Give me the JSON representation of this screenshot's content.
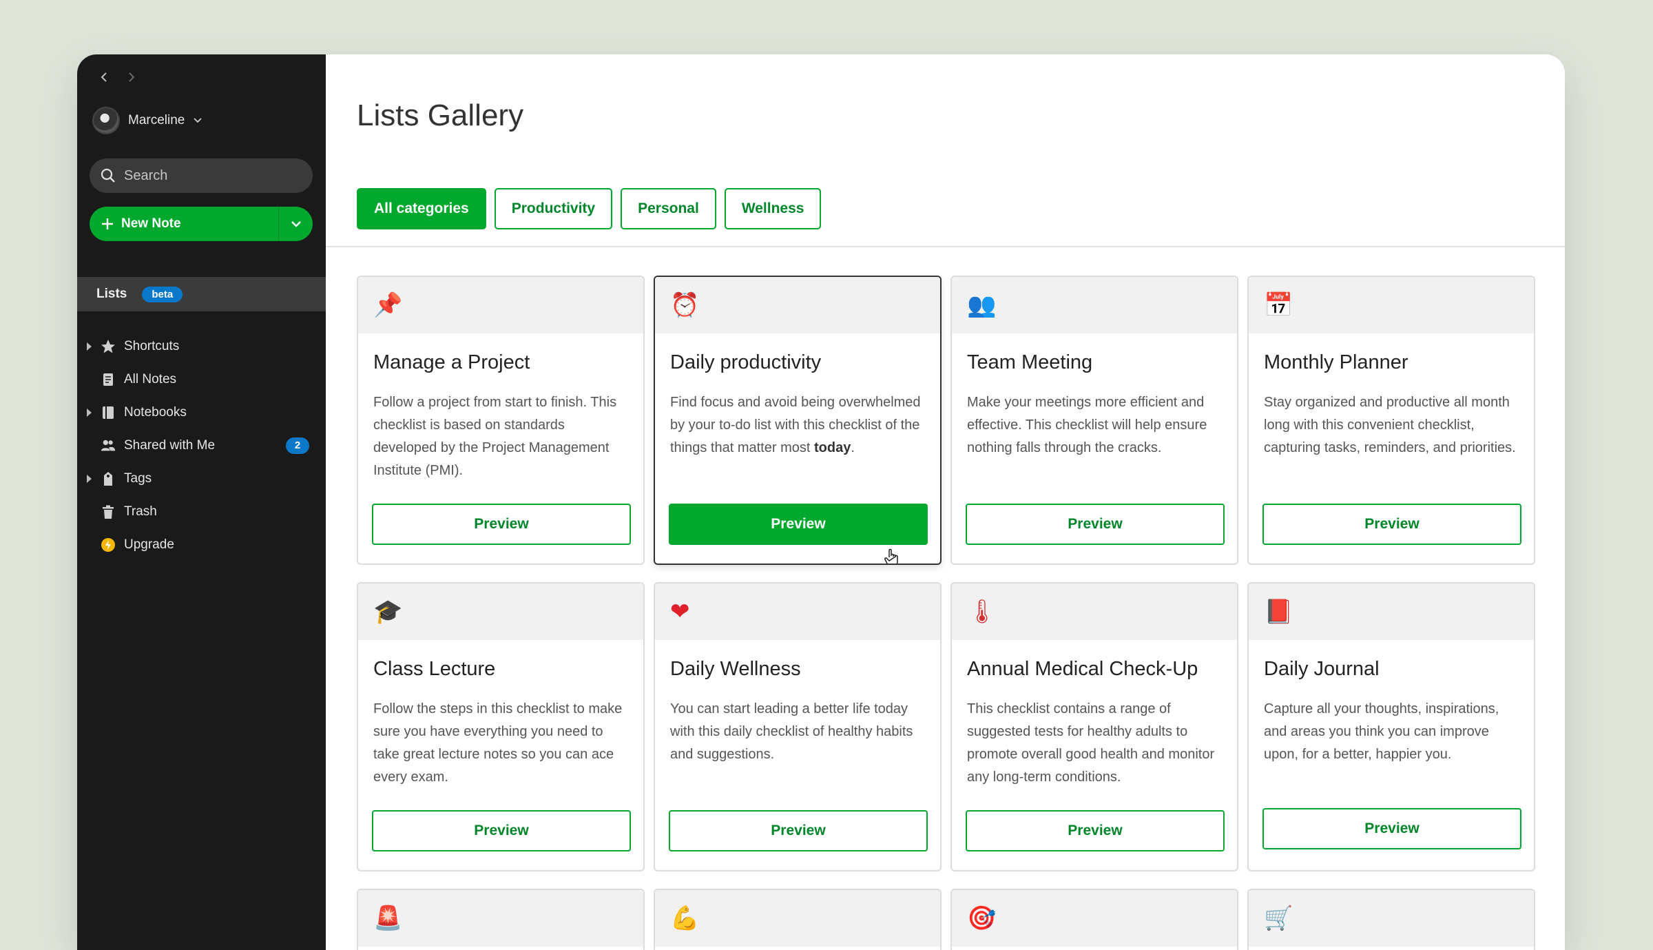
{
  "sidebar": {
    "user": {
      "name": "Marceline"
    },
    "search": {
      "placeholder": "Search"
    },
    "new_note": {
      "label": "New Note"
    },
    "lists": {
      "label": "Lists",
      "badge": "beta"
    },
    "items": [
      {
        "label": "Shortcuts",
        "icon": "star-icon",
        "expandable": true
      },
      {
        "label": "All Notes",
        "icon": "note-icon",
        "expandable": false
      },
      {
        "label": "Notebooks",
        "icon": "notebook-icon",
        "expandable": true
      },
      {
        "label": "Shared with Me",
        "icon": "people-icon",
        "expandable": false,
        "count": "2"
      },
      {
        "label": "Tags",
        "icon": "tag-icon",
        "expandable": true
      },
      {
        "label": "Trash",
        "icon": "trash-icon",
        "expandable": false
      },
      {
        "label": "Upgrade",
        "icon": "upgrade-icon",
        "expandable": false
      }
    ]
  },
  "main": {
    "title": "Lists Gallery",
    "filters": [
      {
        "label": "All categories",
        "active": true
      },
      {
        "label": "Productivity",
        "active": false
      },
      {
        "label": "Personal",
        "active": false
      },
      {
        "label": "Wellness",
        "active": false
      }
    ],
    "preview_label": "Preview",
    "cards": [
      {
        "icon": "pushpin-icon",
        "glyph": "📌",
        "title": "Manage a Project",
        "desc": "Follow a project from start to finish. This checklist is based on standards developed by the Project Management Institute (PMI)."
      },
      {
        "icon": "alarm-clock-icon",
        "glyph": "⏰",
        "title": "Daily productivity",
        "desc_pre": "Find focus and avoid being overwhelmed by your to-do list with this checklist of the things that matter most ",
        "desc_bold": "today",
        "desc_post": "."
      },
      {
        "icon": "people-icon",
        "glyph": "👥",
        "title": "Team Meeting",
        "desc": "Make your meetings more efficient and effective. This checklist will help ensure nothing falls through the cracks."
      },
      {
        "icon": "calendar-icon",
        "glyph": "📅",
        "title": "Monthly Planner",
        "desc": "Stay organized and productive all month long with this convenient checklist, capturing tasks, reminders, and priorities."
      },
      {
        "icon": "graduation-cap-icon",
        "glyph": "🎓",
        "title": "Class Lecture",
        "desc": "Follow the steps in this checklist to make sure you have everything you need to take great lecture notes so you can ace every exam."
      },
      {
        "icon": "heart-icon",
        "glyph": "❤",
        "title": "Daily Wellness",
        "desc": "You can start leading a better life today with this daily checklist of healthy habits and suggestions."
      },
      {
        "icon": "thermometer-icon",
        "glyph": "🌡",
        "title": "Annual Medical Check-Up",
        "desc": "This checklist contains a range of suggested tests for healthy adults to promote overall good health and monitor any long-term conditions."
      },
      {
        "icon": "book-icon",
        "glyph": "📕",
        "title": "Daily Journal",
        "desc": "Capture all your thoughts, inspirations, and areas you think you can improve upon, for a better, happier you."
      }
    ],
    "partial_cards": [
      {
        "icon": "siren-icon",
        "glyph": "🚨"
      },
      {
        "icon": "flexed-biceps-icon",
        "glyph": "💪"
      },
      {
        "icon": "target-icon",
        "glyph": "🎯"
      },
      {
        "icon": "shopping-cart-icon",
        "glyph": "🛒"
      }
    ]
  }
}
